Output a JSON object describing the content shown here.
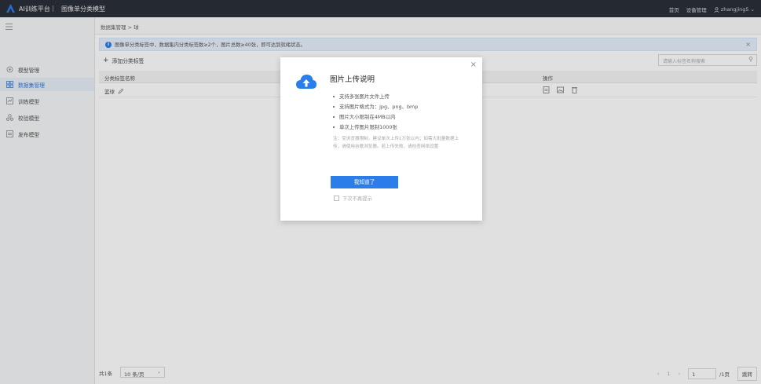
{
  "topbar": {
    "app_title": "AI训练平台",
    "separator": "|",
    "sub_title": "图像单分类模型",
    "nav_home": "首页",
    "nav_device": "设备管理",
    "user": "zhangjing5"
  },
  "sidebar": {
    "items": [
      {
        "label": "模型管理",
        "icon": "model-icon"
      },
      {
        "label": "数据集管理",
        "icon": "dataset-icon"
      },
      {
        "label": "训练模型",
        "icon": "train-icon"
      },
      {
        "label": "校验模型",
        "icon": "validate-icon"
      },
      {
        "label": "发布模型",
        "icon": "publish-icon"
      }
    ],
    "active_index": 1
  },
  "main": {
    "breadcrumb": "数据集管理 > 球",
    "notice": "图像单分类标签中，数据集内分类标签数≥2个，图片总数≥40张，即可达到就绪状态。",
    "add_label": "添加分类标签",
    "search_placeholder": "请输入标签名称搜索",
    "table": {
      "headers": [
        "分类标签名称",
        "操作"
      ],
      "rows": [
        {
          "name": "篮球"
        }
      ]
    },
    "footer": {
      "total": "共1条",
      "page_size": "10 条/页",
      "page_input": "1",
      "page_total": "/1页",
      "go": "跳转"
    }
  },
  "modal": {
    "title": "图片上传说明",
    "bullets": [
      "支持多张图片文件上传",
      "支持图片格式为：jpg、png、bmp",
      "图片大小限制在4MB以内",
      "单次上传图片限制1000张"
    ],
    "note": "注：受浏览器限制，建议单次上传1万张以内；如需大批量数据上传，请使用谷歌浏览器。若上传失败，请检查网络设置",
    "ok_label": "我知道了",
    "checkbox_label": "下次不再提示"
  },
  "colors": {
    "accent": "#2b7de9",
    "topbar": "#2b2f38"
  }
}
